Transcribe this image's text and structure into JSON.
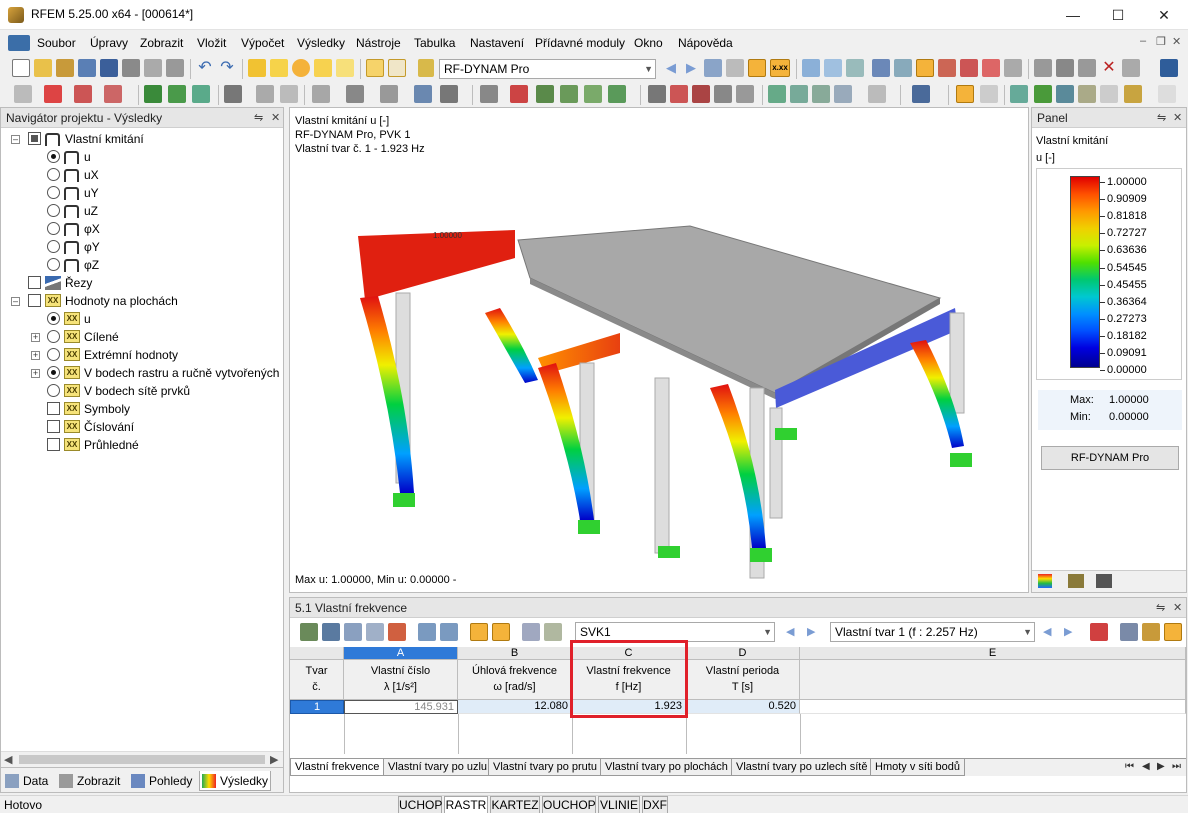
{
  "window": {
    "title": "RFEM 5.25.00 x64 - [000614*]"
  },
  "menu": [
    "Soubor",
    "Úpravy",
    "Zobrazit",
    "Vložit",
    "Výpočet",
    "Výsledky",
    "Nástroje",
    "Tabulka",
    "Nastavení",
    "Přídavné moduly",
    "Okno",
    "Nápověda"
  ],
  "toolbar": {
    "module_combo": "RF-DYNAM Pro",
    "xxx_label": "x.xx"
  },
  "navigator": {
    "title": "Navigátor projektu - Výsledky",
    "items": [
      {
        "label": "Vlastní kmitání"
      },
      {
        "label": "u"
      },
      {
        "label": "uX"
      },
      {
        "label": "uY"
      },
      {
        "label": "uZ"
      },
      {
        "label": "φX"
      },
      {
        "label": "φY"
      },
      {
        "label": "φZ"
      },
      {
        "label": "Řezy"
      },
      {
        "label": "Hodnoty na plochách"
      },
      {
        "label": "u"
      },
      {
        "label": "Cílené"
      },
      {
        "label": "Extrémní hodnoty"
      },
      {
        "label": "V bodech rastru a ručně vytvořených b"
      },
      {
        "label": "V bodech sítě prvků"
      },
      {
        "label": "Symboly"
      },
      {
        "label": "Číslování"
      },
      {
        "label": "Průhledné"
      }
    ],
    "tabs": [
      "Data",
      "Zobrazit",
      "Pohledy",
      "Výsledky"
    ],
    "icon_badge": "XX"
  },
  "viewport": {
    "line1": "Vlastní kmitání u [-]",
    "line2": "RF-DYNAM Pro, PVK 1",
    "line3": "Vlastní tvar č. 1 - 1.923 Hz",
    "max_label": "1.00000",
    "footer": "Max u: 1.00000, Min u: 0.00000 -"
  },
  "panel": {
    "title": "Panel",
    "heading": "Vlastní kmitání",
    "unit": "u [-]",
    "legend": [
      "1.00000",
      "0.90909",
      "0.81818",
      "0.72727",
      "0.63636",
      "0.54545",
      "0.45455",
      "0.36364",
      "0.27273",
      "0.18182",
      "0.09091",
      "0.00000"
    ],
    "max_label": "Max:",
    "max_value": "1.00000",
    "min_label": "Min:",
    "min_value": "0.00000",
    "button": "RF-DYNAM Pro"
  },
  "table": {
    "title": "5.1 Vlastní frekvence",
    "combo1": "SVK1",
    "combo2": "Vlastní tvar 1 (f : 2.257 Hz)",
    "rowhdr1": "Tvar",
    "rowhdr2": "č.",
    "columns": [
      {
        "letter": "A",
        "l1": "Vlastní číslo",
        "l2": "λ [1/s²]"
      },
      {
        "letter": "B",
        "l1": "Úhlová frekvence",
        "l2": "ω [rad/s]"
      },
      {
        "letter": "C",
        "l1": "Vlastní frekvence",
        "l2": "f [Hz]"
      },
      {
        "letter": "D",
        "l1": "Vlastní perioda",
        "l2": "T [s]"
      },
      {
        "letter": "E",
        "l1": "",
        "l2": ""
      }
    ],
    "rows": [
      {
        "n": "1",
        "a": "145.931",
        "b": "12.080",
        "c": "1.923",
        "d": "0.520"
      }
    ],
    "tabs": [
      "Vlastní frekvence",
      "Vlastní tvary po uzlu",
      "Vlastní tvary po prutu",
      "Vlastní tvary po plochách",
      "Vlastní tvary po uzlech sítě",
      "Hmoty v síti bodů"
    ]
  },
  "statusbar": {
    "text": "Hotovo",
    "buttons": [
      "UCHOP",
      "RASTR",
      "KARTEZ",
      "OUCHOP",
      "VLINIE",
      "DXF"
    ]
  },
  "colors": {
    "highlight": "#e0202a",
    "selected": "#3a78d4"
  }
}
